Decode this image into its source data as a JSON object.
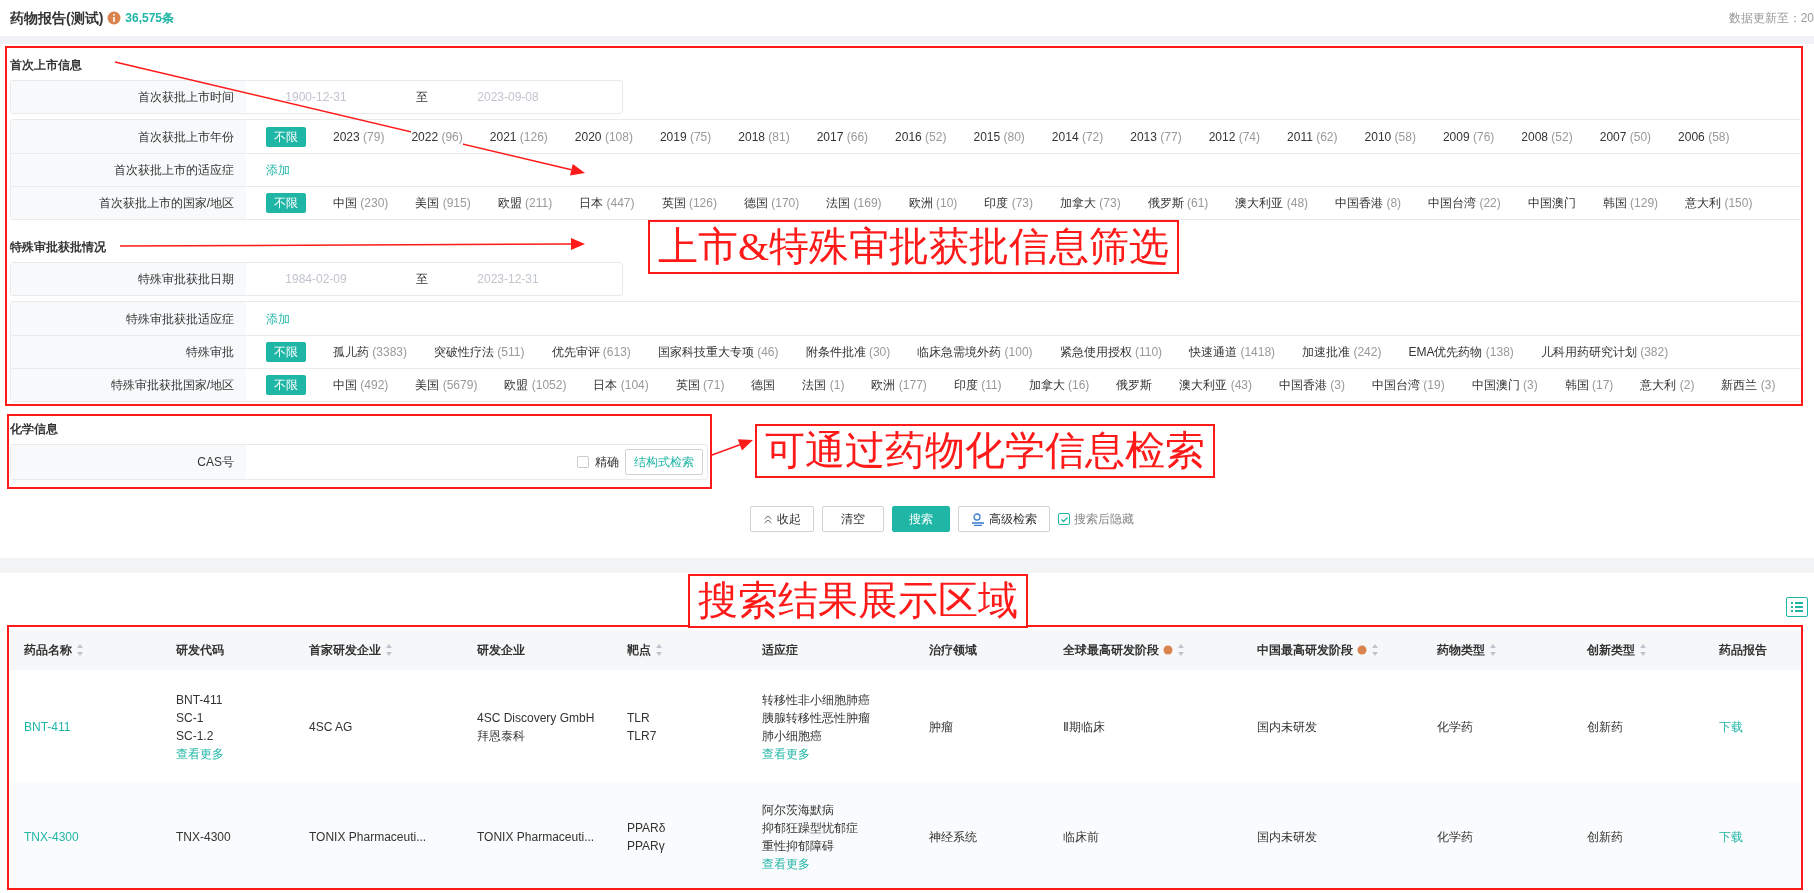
{
  "header": {
    "title": "药物报告(测试)",
    "count": "36,575条",
    "update_label": "数据更新至：20"
  },
  "sections": [
    {
      "title": "首次上市信息",
      "rows": [
        {
          "kind": "date_range",
          "label": "首次获批上市时间",
          "start": {
            "placeholder": "1900-12-31"
          },
          "separator": "至",
          "end": {
            "placeholder": "2023-09-08"
          }
        },
        {
          "kind": "options",
          "label": "首次获批上市年份",
          "options": [
            {
              "name": "不限",
              "selected": true
            },
            {
              "name": "2023",
              "count": "(79)",
              "selected": false
            },
            {
              "name": "2022",
              "count": "(96)",
              "selected": false
            },
            {
              "name": "2021",
              "count": "(126)",
              "selected": false
            },
            {
              "name": "2020",
              "count": "(108)",
              "selected": false
            },
            {
              "name": "2019",
              "count": "(75)",
              "selected": false
            },
            {
              "name": "2018",
              "count": "(81)",
              "selected": false
            },
            {
              "name": "2017",
              "count": "(66)",
              "selected": false
            },
            {
              "name": "2016",
              "count": "(52)",
              "selected": false
            },
            {
              "name": "2015",
              "count": "(80)",
              "selected": false
            },
            {
              "name": "2014",
              "count": "(72)",
              "selected": false
            },
            {
              "name": "2013",
              "count": "(77)",
              "selected": false
            },
            {
              "name": "2012",
              "count": "(74)",
              "selected": false
            },
            {
              "name": "2011",
              "count": "(62)",
              "selected": false
            },
            {
              "name": "2010",
              "count": "(58)",
              "selected": false
            },
            {
              "name": "2009",
              "count": "(76)",
              "selected": false
            },
            {
              "name": "2008",
              "count": "(52)",
              "selected": false
            },
            {
              "name": "2007",
              "count": "(50)",
              "selected": false
            },
            {
              "name": "2006",
              "count": "(58)",
              "selected": false
            }
          ]
        },
        {
          "kind": "add",
          "label": "首次获批上市的适应症",
          "link": "添加"
        },
        {
          "kind": "options",
          "label": "首次获批上市的国家/地区",
          "options": [
            {
              "name": "不限",
              "selected": true
            },
            {
              "name": "中国",
              "count": "(230)",
              "selected": false
            },
            {
              "name": "美国",
              "count": "(915)",
              "selected": false
            },
            {
              "name": "欧盟",
              "count": "(211)",
              "selected": false
            },
            {
              "name": "日本",
              "count": "(447)",
              "selected": false
            },
            {
              "name": "英国",
              "count": "(126)",
              "selected": false
            },
            {
              "name": "德国",
              "count": "(170)",
              "selected": false
            },
            {
              "name": "法国",
              "count": "(169)",
              "selected": false
            },
            {
              "name": "欧洲",
              "count": "(10)",
              "selected": false
            },
            {
              "name": "印度",
              "count": "(73)",
              "selected": false
            },
            {
              "name": "加拿大",
              "count": "(73)",
              "selected": false
            },
            {
              "name": "俄罗斯",
              "count": "(61)",
              "selected": false
            },
            {
              "name": "澳大利亚",
              "count": "(48)",
              "selected": false
            },
            {
              "name": "中国香港",
              "count": "(8)",
              "selected": false
            },
            {
              "name": "中国台湾",
              "count": "(22)",
              "selected": false
            },
            {
              "name": "中国澳门",
              "selected": false
            },
            {
              "name": "韩国",
              "count": "(129)",
              "selected": false
            },
            {
              "name": "意大利",
              "count": "(150)",
              "selected": false
            }
          ]
        }
      ]
    },
    {
      "title": "特殊审批获批情况",
      "rows": [
        {
          "kind": "date_range",
          "label": "特殊审批获批日期",
          "start": {
            "placeholder": "1984-02-09"
          },
          "separator": "至",
          "end": {
            "placeholder": "2023-12-31"
          }
        },
        {
          "kind": "add",
          "label": "特殊审批获批适应症",
          "link": "添加"
        },
        {
          "kind": "options",
          "label": "特殊审批",
          "options": [
            {
              "name": "不限",
              "selected": true
            },
            {
              "name": "孤儿药",
              "count": "(3383)",
              "selected": false
            },
            {
              "name": "突破性疗法",
              "count": "(511)",
              "selected": false
            },
            {
              "name": "优先审评",
              "count": "(613)",
              "selected": false
            },
            {
              "name": "国家科技重大专项",
              "count": "(46)",
              "selected": false
            },
            {
              "name": "附条件批准",
              "count": "(30)",
              "selected": false
            },
            {
              "name": "临床急需境外药",
              "count": "(100)",
              "selected": false
            },
            {
              "name": "紧急使用授权",
              "count": "(110)",
              "selected": false
            },
            {
              "name": "快速通道",
              "count": "(1418)",
              "selected": false
            },
            {
              "name": "加速批准",
              "count": "(242)",
              "selected": false
            },
            {
              "name": "EMA优先药物",
              "count": "(138)",
              "selected": false
            },
            {
              "name": "儿科用药研究计划",
              "count": "(382)",
              "selected": false
            }
          ]
        },
        {
          "kind": "options",
          "label": "特殊审批获批国家/地区",
          "options": [
            {
              "name": "不限",
              "selected": true
            },
            {
              "name": "中国",
              "count": "(492)",
              "selected": false
            },
            {
              "name": "美国",
              "count": "(5679)",
              "selected": false
            },
            {
              "name": "欧盟",
              "count": "(1052)",
              "selected": false
            },
            {
              "name": "日本",
              "count": "(104)",
              "selected": false
            },
            {
              "name": "英国",
              "count": "(71)",
              "selected": false
            },
            {
              "name": "德国",
              "selected": false
            },
            {
              "name": "法国",
              "count": "(1)",
              "selected": false
            },
            {
              "name": "欧洲",
              "count": "(177)",
              "selected": false
            },
            {
              "name": "印度",
              "count": "(11)",
              "selected": false
            },
            {
              "name": "加拿大",
              "count": "(16)",
              "selected": false
            },
            {
              "name": "俄罗斯",
              "selected": false
            },
            {
              "name": "澳大利亚",
              "count": "(43)",
              "selected": false
            },
            {
              "name": "中国香港",
              "count": "(3)",
              "selected": false
            },
            {
              "name": "中国台湾",
              "count": "(19)",
              "selected": false
            },
            {
              "name": "中国澳门",
              "count": "(3)",
              "selected": false
            },
            {
              "name": "韩国",
              "count": "(17)",
              "selected": false
            },
            {
              "name": "意大利",
              "count": "(2)",
              "selected": false
            },
            {
              "name": "新西兰",
              "count": "(3)",
              "selected": false
            }
          ]
        }
      ]
    },
    {
      "title": "化学信息",
      "rows": [
        {
          "kind": "text_input",
          "label": "CAS号",
          "checkbox": {
            "label": "精确",
            "checked": false
          },
          "button": "结构式检索"
        }
      ]
    }
  ],
  "actions": [
    {
      "kind": "collapse",
      "label": "收起"
    },
    {
      "kind": "plain",
      "label": "清空"
    },
    {
      "kind": "primary",
      "label": "搜索"
    },
    {
      "kind": "advanced",
      "label": "高级检索"
    }
  ],
  "hide_after_search": {
    "label": "搜索后隐藏",
    "checked": true
  },
  "table": {
    "columns": [
      {
        "label": "药品名称",
        "sortable": true,
        "info": false
      },
      {
        "label": "研发代码",
        "sortable": false,
        "info": false
      },
      {
        "label": "首家研发企业",
        "sortable": true,
        "info": false
      },
      {
        "label": "研发企业",
        "sortable": false,
        "info": false
      },
      {
        "label": "靶点",
        "sortable": true,
        "info": false
      },
      {
        "label": "适应症",
        "sortable": false,
        "info": false
      },
      {
        "label": "治疗领域",
        "sortable": false,
        "info": false
      },
      {
        "label": "全球最高研发阶段",
        "sortable": true,
        "info": true
      },
      {
        "label": "中国最高研发阶段",
        "sortable": true,
        "info": true
      },
      {
        "label": "药物类型",
        "sortable": true,
        "info": false
      },
      {
        "label": "创新类型",
        "sortable": true,
        "info": false
      },
      {
        "label": "药品报告",
        "sortable": false,
        "info": false
      }
    ],
    "rows": [
      {
        "cells": [
          {
            "kind": "link",
            "text": "BNT-411"
          },
          {
            "kind": "list",
            "lines": [
              "BNT-411",
              "SC-1",
              "SC-1.2"
            ],
            "more": "查看更多"
          },
          {
            "kind": "text",
            "text": "4SC AG"
          },
          {
            "kind": "list",
            "lines": [
              "4SC Discovery GmbH",
              "拜恩泰科"
            ]
          },
          {
            "kind": "list",
            "lines": [
              "TLR",
              "TLR7"
            ]
          },
          {
            "kind": "list",
            "lines": [
              "转移性非小细胞肺癌",
              "胰腺转移性恶性肿瘤",
              "肺小细胞癌"
            ],
            "more": "查看更多"
          },
          {
            "kind": "text",
            "text": "肿瘤"
          },
          {
            "kind": "text",
            "text": "Ⅱ期临床"
          },
          {
            "kind": "text",
            "text": "国内未研发"
          },
          {
            "kind": "text",
            "text": "化学药"
          },
          {
            "kind": "text",
            "text": "创新药"
          },
          {
            "kind": "link",
            "text": "下载"
          }
        ]
      },
      {
        "cells": [
          {
            "kind": "link",
            "text": "TNX-4300"
          },
          {
            "kind": "text",
            "text": "TNX-4300"
          },
          {
            "kind": "text",
            "text": "TONIX Pharmaceuti..."
          },
          {
            "kind": "text",
            "text": "TONIX Pharmaceuti..."
          },
          {
            "kind": "list",
            "lines": [
              "PPARδ",
              "PPARγ"
            ]
          },
          {
            "kind": "list",
            "lines": [
              "阿尔茨海默病",
              "抑郁狂躁型忧郁症",
              "重性抑郁障碍"
            ],
            "more": "查看更多"
          },
          {
            "kind": "text",
            "text": "神经系统"
          },
          {
            "kind": "text",
            "text": "临床前"
          },
          {
            "kind": "text",
            "text": "国内未研发"
          },
          {
            "kind": "text",
            "text": "化学药"
          },
          {
            "kind": "text",
            "text": "创新药"
          },
          {
            "kind": "link",
            "text": "下载"
          }
        ]
      }
    ]
  },
  "annotations": [
    {
      "text": "上市&特殊审批获批信息筛选"
    },
    {
      "text": "可通过药物化学信息检索"
    },
    {
      "text": "搜索结果展示区域"
    }
  ]
}
